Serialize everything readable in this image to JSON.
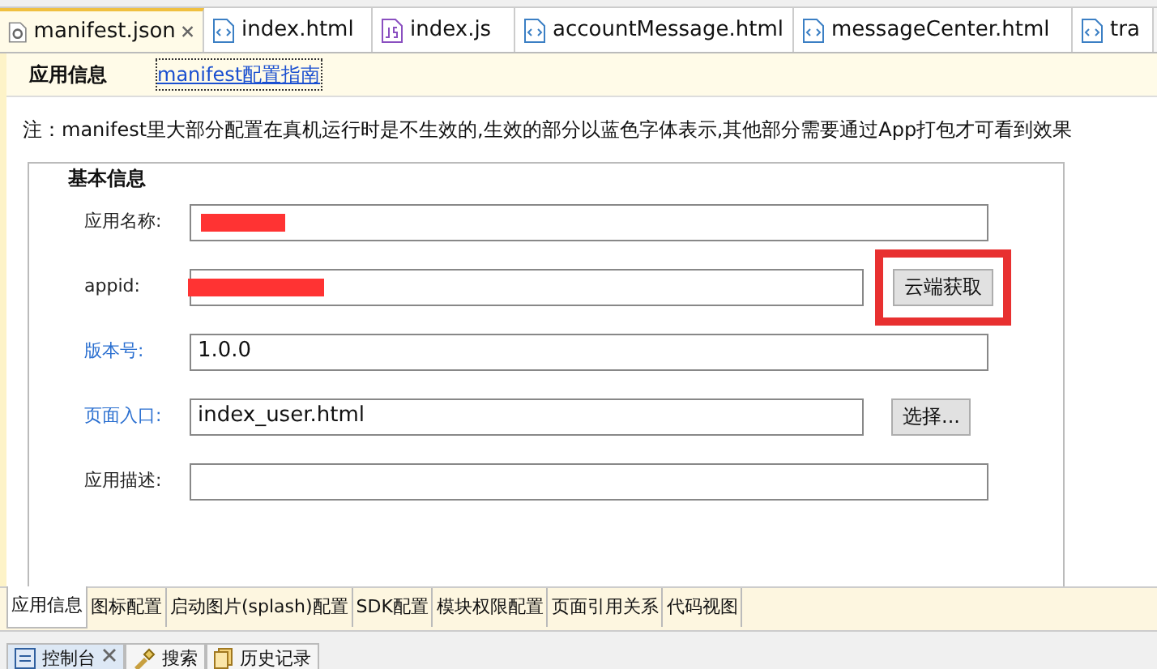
{
  "editor_tabs": [
    {
      "label": "manifest.json",
      "kind": "json",
      "selected": true,
      "closable": true
    },
    {
      "label": "index.html",
      "kind": "html",
      "selected": false,
      "closable": false
    },
    {
      "label": "index.js",
      "kind": "js",
      "selected": false,
      "closable": false
    },
    {
      "label": "accountMessage.html",
      "kind": "html",
      "selected": false,
      "closable": false
    },
    {
      "label": "messageCenter.html",
      "kind": "html",
      "selected": false,
      "closable": false
    },
    {
      "label": "tra",
      "kind": "html",
      "selected": false,
      "closable": false
    }
  ],
  "header": {
    "title": "应用信息",
    "link": "manifest配置指南"
  },
  "note": "注：manifest里大部分配置在真机运行时是不生效的,生效的部分以蓝色字体表示,其他部分需要通过App打包才可看到效果",
  "group": {
    "title": "基本信息",
    "fields": [
      {
        "label": "应用名称:",
        "effective": false,
        "redacted": true
      },
      {
        "label": "appid:",
        "effective": false,
        "redacted": true,
        "button": "云端获取",
        "button_flagged": true
      },
      {
        "label": "版本号:",
        "effective": true,
        "value": "1.0.0"
      },
      {
        "label": "页面入口:",
        "effective": true,
        "value": "index_user.html",
        "button": "选择...",
        "button_flagged": false
      },
      {
        "label": "应用描述:",
        "effective": false
      }
    ]
  },
  "bottom_tabs": [
    {
      "label": "应用信息",
      "selected": true
    },
    {
      "label": "图标配置",
      "selected": false
    },
    {
      "label": "启动图片(splash)配置",
      "selected": false
    },
    {
      "label": "SDK配置",
      "selected": false
    },
    {
      "label": "模块权限配置",
      "selected": false
    },
    {
      "label": "页面引用关系",
      "selected": false
    },
    {
      "label": "代码视图",
      "selected": false
    }
  ],
  "panel_tabs": [
    {
      "label": "控制台",
      "kind": "console",
      "selected": true,
      "closable": true
    },
    {
      "label": "搜索",
      "kind": "search",
      "selected": false,
      "closable": false
    },
    {
      "label": "历史记录",
      "kind": "history",
      "selected": false,
      "closable": false
    }
  ]
}
